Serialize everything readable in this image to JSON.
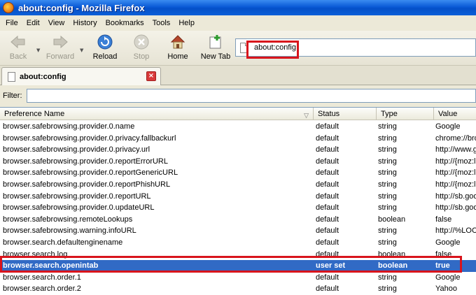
{
  "window": {
    "title": "about:config - Mozilla Firefox"
  },
  "menu": [
    "File",
    "Edit",
    "View",
    "History",
    "Bookmarks",
    "Tools",
    "Help"
  ],
  "toolbar": {
    "back": "Back",
    "forward": "Forward",
    "reload": "Reload",
    "stop": "Stop",
    "home": "Home",
    "new_tab": "New Tab"
  },
  "urlbar": {
    "value": "about:config"
  },
  "tab": {
    "label": "about:config"
  },
  "filter": {
    "label": "Filter:",
    "value": ""
  },
  "columns": {
    "name": "Preference Name",
    "status": "Status",
    "type": "Type",
    "value": "Value"
  },
  "rows": [
    {
      "name": "browser.safebrowsing.provider.0.name",
      "status": "default",
      "type": "string",
      "value": "Google"
    },
    {
      "name": "browser.safebrowsing.provider.0.privacy.fallbackurl",
      "status": "default",
      "type": "string",
      "value": "chrome://bro"
    },
    {
      "name": "browser.safebrowsing.provider.0.privacy.url",
      "status": "default",
      "type": "string",
      "value": "http://www.g"
    },
    {
      "name": "browser.safebrowsing.provider.0.reportErrorURL",
      "status": "default",
      "type": "string",
      "value": "http://{moz:l"
    },
    {
      "name": "browser.safebrowsing.provider.0.reportGenericURL",
      "status": "default",
      "type": "string",
      "value": "http://{moz:l"
    },
    {
      "name": "browser.safebrowsing.provider.0.reportPhishURL",
      "status": "default",
      "type": "string",
      "value": "http://{moz:l"
    },
    {
      "name": "browser.safebrowsing.provider.0.reportURL",
      "status": "default",
      "type": "string",
      "value": "http://sb.goo"
    },
    {
      "name": "browser.safebrowsing.provider.0.updateURL",
      "status": "default",
      "type": "string",
      "value": "http://sb.goo"
    },
    {
      "name": "browser.safebrowsing.remoteLookups",
      "status": "default",
      "type": "boolean",
      "value": "false"
    },
    {
      "name": "browser.safebrowsing.warning.infoURL",
      "status": "default",
      "type": "string",
      "value": "http://%LOC"
    },
    {
      "name": "browser.search.defaultenginename",
      "status": "default",
      "type": "string",
      "value": "Google"
    },
    {
      "name": "browser.search.log",
      "status": "default",
      "type": "boolean",
      "value": "false"
    },
    {
      "name": "browser.search.openintab",
      "status": "user set",
      "type": "boolean",
      "value": "true"
    },
    {
      "name": "browser.search.order.1",
      "status": "default",
      "type": "string",
      "value": "Google"
    },
    {
      "name": "browser.search.order.2",
      "status": "default",
      "type": "string",
      "value": "Yahoo"
    }
  ],
  "selected_index": 12,
  "colors": {
    "selection": "#316ac5",
    "highlight_box": "#d8141c",
    "titlebar": "#0a5ad6"
  }
}
